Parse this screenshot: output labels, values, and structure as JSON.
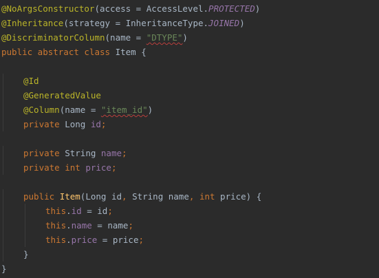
{
  "editor": {
    "colors": {
      "background": "#2b2b2b",
      "plain": "#a9b7c6",
      "annotation": "#bbb529",
      "keyword": "#cc7832",
      "string": "#6a8759",
      "field": "#9876aa",
      "function": "#ffc66d"
    },
    "lines": [
      {
        "indent": 0,
        "tokens": [
          {
            "t": "@NoArgsConstructor",
            "c": "annotation"
          },
          {
            "t": "(access = AccessLevel.",
            "c": "plain"
          },
          {
            "t": "PROTECTED",
            "c": "enum"
          },
          {
            "t": ")",
            "c": "plain"
          }
        ]
      },
      {
        "indent": 0,
        "tokens": [
          {
            "t": "@Inheritance",
            "c": "annotation"
          },
          {
            "t": "(strategy = InheritanceType.",
            "c": "plain"
          },
          {
            "t": "JOINED",
            "c": "enum"
          },
          {
            "t": ")",
            "c": "plain"
          }
        ]
      },
      {
        "indent": 0,
        "tokens": [
          {
            "t": "@DiscriminatorColumn",
            "c": "annotation"
          },
          {
            "t": "(name = ",
            "c": "plain"
          },
          {
            "t": "\"DTYPE\"",
            "c": "string",
            "squiggle": true
          },
          {
            "t": ")",
            "c": "plain"
          }
        ]
      },
      {
        "indent": 0,
        "tokens": [
          {
            "t": "public abstract class ",
            "c": "keyword"
          },
          {
            "t": "Item {",
            "c": "plain"
          }
        ]
      },
      {
        "indent": 0,
        "tokens": []
      },
      {
        "indent": 1,
        "tokens": [
          {
            "t": "@Id",
            "c": "annotation"
          }
        ]
      },
      {
        "indent": 1,
        "tokens": [
          {
            "t": "@GeneratedValue",
            "c": "annotation"
          }
        ]
      },
      {
        "indent": 1,
        "tokens": [
          {
            "t": "@Column",
            "c": "annotation"
          },
          {
            "t": "(name = ",
            "c": "plain"
          },
          {
            "t": "\"item_id\"",
            "c": "string",
            "squiggle": true
          },
          {
            "t": ")",
            "c": "plain"
          }
        ]
      },
      {
        "indent": 1,
        "tokens": [
          {
            "t": "private ",
            "c": "keyword"
          },
          {
            "t": "Long ",
            "c": "plain"
          },
          {
            "t": "id",
            "c": "field"
          },
          {
            "t": ";",
            "c": "keyword"
          }
        ]
      },
      {
        "indent": 0,
        "tokens": []
      },
      {
        "indent": 1,
        "tokens": [
          {
            "t": "private ",
            "c": "keyword"
          },
          {
            "t": "String ",
            "c": "plain"
          },
          {
            "t": "name",
            "c": "field"
          },
          {
            "t": ";",
            "c": "keyword"
          }
        ]
      },
      {
        "indent": 1,
        "tokens": [
          {
            "t": "private int ",
            "c": "keyword"
          },
          {
            "t": "price",
            "c": "field"
          },
          {
            "t": ";",
            "c": "keyword"
          }
        ]
      },
      {
        "indent": 0,
        "tokens": []
      },
      {
        "indent": 1,
        "tokens": [
          {
            "t": "public ",
            "c": "keyword"
          },
          {
            "t": "Item",
            "c": "function"
          },
          {
            "t": "(Long id",
            "c": "plain"
          },
          {
            "t": ", ",
            "c": "keyword"
          },
          {
            "t": "String name",
            "c": "plain"
          },
          {
            "t": ", ",
            "c": "keyword"
          },
          {
            "t": "int ",
            "c": "keyword"
          },
          {
            "t": "price) {",
            "c": "plain"
          }
        ]
      },
      {
        "indent": 2,
        "tokens": [
          {
            "t": "this",
            "c": "keyword"
          },
          {
            "t": ".",
            "c": "plain"
          },
          {
            "t": "id",
            "c": "field"
          },
          {
            "t": " = id",
            "c": "plain"
          },
          {
            "t": ";",
            "c": "keyword"
          }
        ]
      },
      {
        "indent": 2,
        "tokens": [
          {
            "t": "this",
            "c": "keyword"
          },
          {
            "t": ".",
            "c": "plain"
          },
          {
            "t": "name",
            "c": "field"
          },
          {
            "t": " = name",
            "c": "plain"
          },
          {
            "t": ";",
            "c": "keyword"
          }
        ]
      },
      {
        "indent": 2,
        "tokens": [
          {
            "t": "this",
            "c": "keyword"
          },
          {
            "t": ".",
            "c": "plain"
          },
          {
            "t": "price",
            "c": "field"
          },
          {
            "t": " = price",
            "c": "plain"
          },
          {
            "t": ";",
            "c": "keyword"
          }
        ]
      },
      {
        "indent": 1,
        "tokens": [
          {
            "t": "}",
            "c": "plain"
          }
        ]
      },
      {
        "indent": 0,
        "tokens": [
          {
            "t": "}",
            "c": "plain"
          }
        ]
      }
    ]
  }
}
